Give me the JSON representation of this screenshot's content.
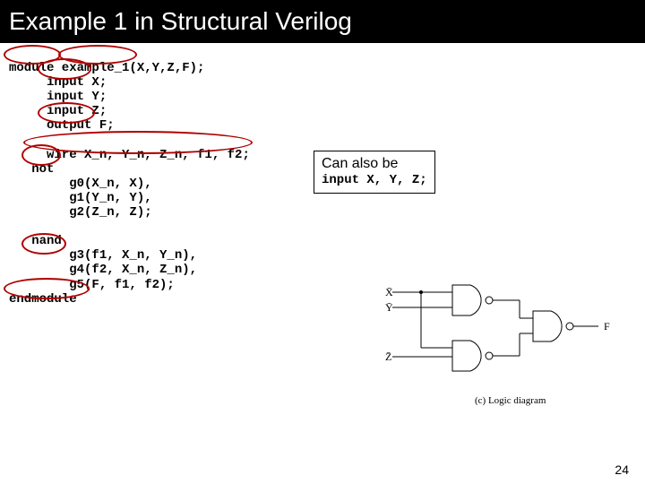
{
  "title": "Example 1 in Structural Verilog",
  "code": {
    "l1": "module example_1(X,Y,Z,F);",
    "l2": "     input X;",
    "l3": "     input Y;",
    "l4": "     input Z;",
    "l5": "     output F;",
    "l6": "",
    "l7": "     wire X_n, Y_n, Z_n, f1, f2;",
    "l8": "   not",
    "l9": "        g0(X_n, X),",
    "l10": "        g1(Y_n, Y),",
    "l11": "        g2(Z_n, Z);",
    "l12": "",
    "l13": "   nand",
    "l14": "        g3(f1, X_n, Y_n),",
    "l15": "        g4(f2, X_n, Z_n),",
    "l16": "        g5(F, f1, f2);",
    "l17": "endmodule"
  },
  "note": {
    "line1": "Can also be",
    "line2": "  input X, Y, Z;"
  },
  "diagram": {
    "caption": "(c) Logic diagram",
    "inputs": {
      "x": "X",
      "y": "Y",
      "z": "Z"
    },
    "output": "F"
  },
  "pagenum": "24"
}
